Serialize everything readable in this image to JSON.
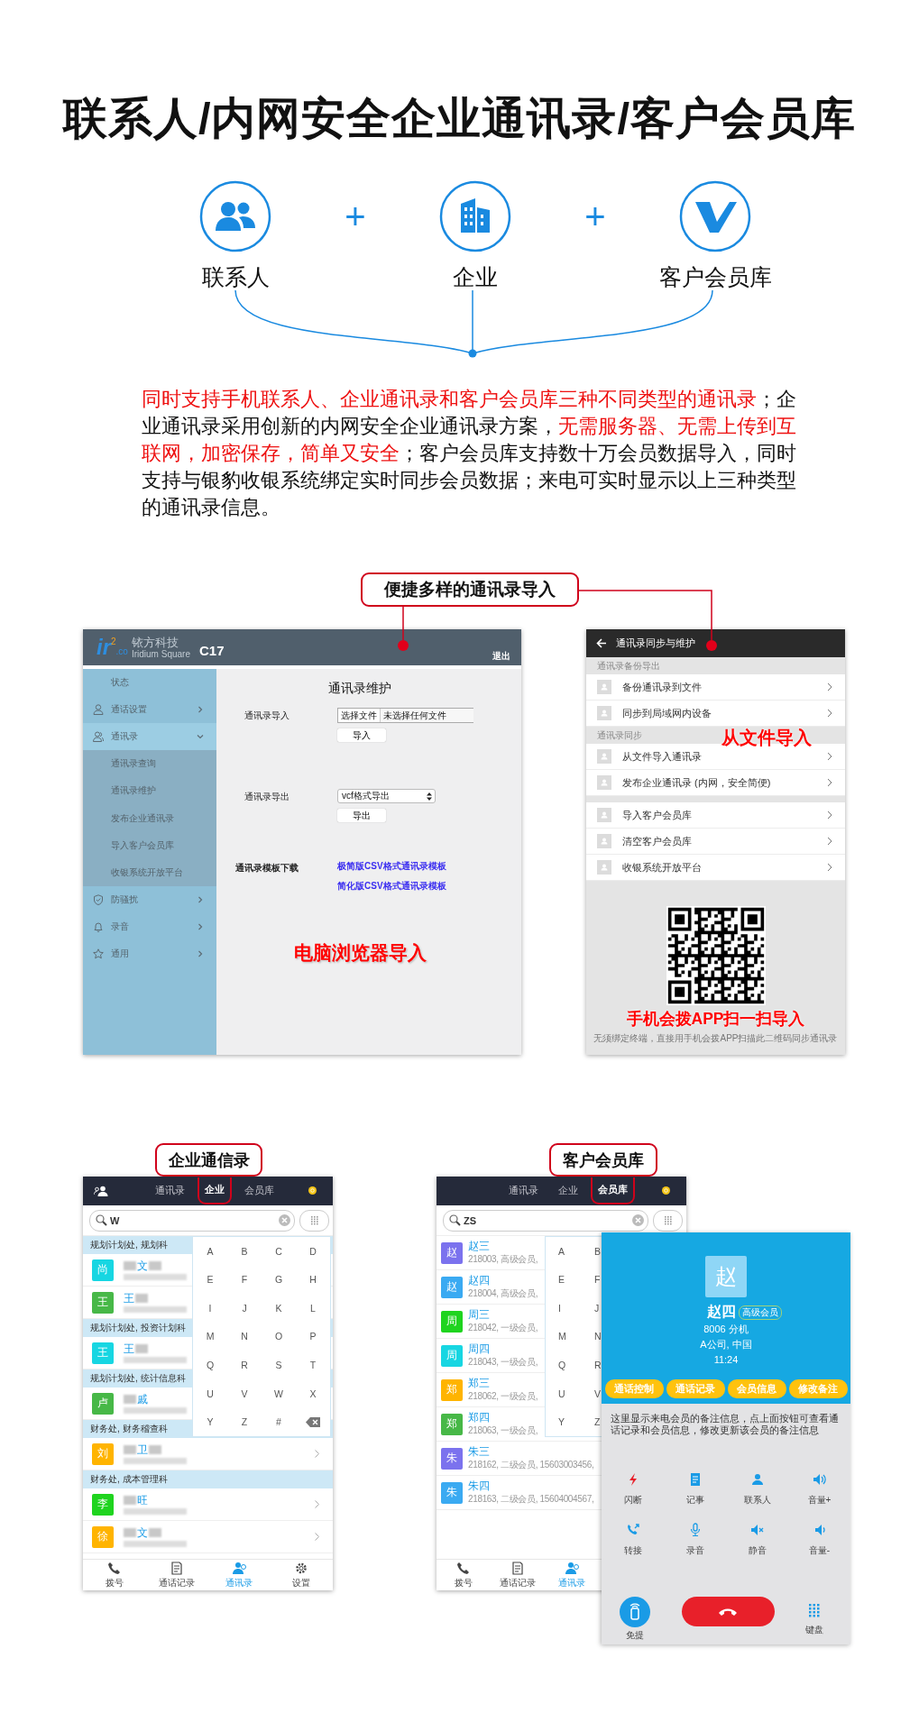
{
  "title": "联系人/内网安全企业通讯录/客户会员库",
  "features": [
    {
      "label": "联系人",
      "kind": "contacts"
    },
    {
      "label": "企业",
      "kind": "building"
    },
    {
      "label": "客户会员库",
      "kind": "logo"
    }
  ],
  "feature_joiners": [
    "+",
    "+"
  ],
  "description": [
    {
      "text": "同时支持手机联系人、企业通讯录和客户会员库三种不同类型的通讯录",
      "highlighted": true
    },
    {
      "text": "；企业通讯录采用创新的内网安全企业通讯录方案，",
      "highlighted": false
    },
    {
      "text": "无需服务器、无需上传到互联网，加密保存，简单又安全",
      "highlighted": true
    },
    {
      "text": "；客户会员库支持数十万会员数据导入，同时支持与银豹收银系统绑定实时同步会员数据；来电可实时显示以上三种类型的通讯录信息。",
      "highlighted": false
    }
  ],
  "import_callout": "便捷多样的通讯录导入",
  "web_admin": {
    "logo_letters": "ir",
    "logo_exponent": "2",
    "logo_domain": ".co",
    "brand": "铱方科技",
    "brand_sub": "Iridium Square",
    "model": "C17",
    "logout": "退出",
    "menu": [
      {
        "label": "状态",
        "kind": "plain",
        "expandable": false
      },
      {
        "label": "通话设置",
        "kind": "person",
        "expandable": true,
        "expanded": false
      },
      {
        "label": "通讯录",
        "kind": "people",
        "expandable": true,
        "expanded": true,
        "children": [
          {
            "label": "通讯录查询"
          },
          {
            "label": "通讯录维护"
          },
          {
            "label": "发布企业通讯录"
          },
          {
            "label": "导入客户会员库"
          },
          {
            "label": "收银系统开放平台"
          }
        ]
      },
      {
        "label": "防骚扰",
        "kind": "shield",
        "expandable": true,
        "expanded": false
      },
      {
        "label": "录音",
        "kind": "bell",
        "expandable": true,
        "expanded": false
      },
      {
        "label": "通用",
        "kind": "star",
        "expandable": true,
        "expanded": false
      }
    ],
    "heading": "通讯录维护",
    "import": {
      "label": "通讯录导入",
      "file_button": "选择文件",
      "file_status": "未选择任何文件",
      "button": "导入"
    },
    "export": {
      "label": "通讯录导出",
      "format": "vcf格式导出",
      "button": "导出"
    },
    "templates": {
      "label": "通讯录模板下载",
      "links": [
        "极简版CSV格式通讯录模板",
        "简化版CSV格式通讯录模板"
      ]
    },
    "caption": "电脑浏览器导入"
  },
  "mobile_sync": {
    "title": "通讯录同步与维护",
    "sections": [
      {
        "header": "通讯录备份导出",
        "items": [
          "备份通讯录到文件",
          "同步到局域网内设备"
        ]
      },
      {
        "header": "通讯录同步",
        "items": [
          "从文件导入通讯录",
          "发布企业通讯录 (内网，安全简便)"
        ]
      },
      {
        "items": [
          "导入客户会员库",
          "清空客户会员库",
          "收银系统开放平台"
        ]
      }
    ],
    "overlay_caption": "从文件导入",
    "qr_caption": "手机会拨APP扫一扫导入",
    "qr_note": "无须绑定终端，直接用手机会拨APP扫描此二维码同步通讯录"
  },
  "enterprise_phone": {
    "callout": "企业通信录",
    "account_icon": true,
    "tabs": [
      {
        "label": "通讯录",
        "selected": false
      },
      {
        "label": "企业",
        "selected": true
      },
      {
        "label": "会员库",
        "selected": false
      }
    ],
    "search": {
      "value": "W"
    },
    "groups": [
      {
        "header": "规划计划处, 规划科",
        "contacts": [
          {
            "avatar": "尚",
            "color": "#17d6e2",
            "name": "文",
            "kind": "both"
          },
          {
            "avatar": "王",
            "color": "#47b847",
            "name": "王",
            "kind": "after"
          }
        ]
      },
      {
        "header": "规划计划处, 投资计划科",
        "contacts": [
          {
            "avatar": "王",
            "color": "#17d6e2",
            "name": "王",
            "kind": "after"
          }
        ]
      },
      {
        "header": "规划计划处, 统计信息科",
        "contacts": [
          {
            "avatar": "卢",
            "color": "#47b847",
            "name": "戚",
            "kind": "before"
          }
        ]
      },
      {
        "header": "财务处, 财务稽查科",
        "contacts": [
          {
            "avatar": "刘",
            "color": "#ffb400",
            "name": "卫",
            "kind": "both",
            "arrow": true
          }
        ]
      },
      {
        "header": "财务处, 成本管理科",
        "contacts": [
          {
            "avatar": "李",
            "color": "#1fd41f",
            "name": "旺",
            "kind": "before",
            "arrow": true
          },
          {
            "avatar": "徐",
            "color": "#ffb400",
            "name": "文",
            "kind": "both",
            "arrow": true
          }
        ]
      }
    ],
    "keyboard": [
      [
        "A",
        "B",
        "C",
        "D"
      ],
      [
        "E",
        "F",
        "G",
        "H"
      ],
      [
        "I",
        "J",
        "K",
        "L"
      ],
      [
        "M",
        "N",
        "O",
        "P"
      ],
      [
        "Q",
        "R",
        "S",
        "T"
      ],
      [
        "U",
        "V",
        "W",
        "X"
      ],
      [
        "Y",
        "Z",
        "#"
      ]
    ],
    "delete_key": true,
    "nav": [
      {
        "label": "拨号",
        "kind": "phone",
        "selected": false
      },
      {
        "label": "通话记录",
        "kind": "history",
        "selected": false
      },
      {
        "label": "通讯录",
        "kind": "contacts",
        "selected": true
      },
      {
        "label": "设置",
        "kind": "gear",
        "selected": false
      }
    ]
  },
  "member_phone": {
    "callout": "客户会员库",
    "tabs": [
      {
        "label": "通讯录",
        "selected": false
      },
      {
        "label": "企业",
        "selected": false
      },
      {
        "label": "会员库",
        "selected": true
      }
    ],
    "search": {
      "value": "ZS"
    },
    "members": [
      {
        "avatar": "赵",
        "color": "#7b72ee",
        "name": "赵三",
        "detail": "218003, 高级会员,"
      },
      {
        "avatar": "赵",
        "color": "#3aaaf2",
        "name": "赵四",
        "detail": "218004, 高级会员,"
      },
      {
        "avatar": "周",
        "color": "#1fd41f",
        "name": "周三",
        "detail": "218042, 一级会员,"
      },
      {
        "avatar": "周",
        "color": "#17d6e2",
        "name": "周四",
        "detail": "218043, 一级会员,"
      },
      {
        "avatar": "郑",
        "color": "#ffb400",
        "name": "郑三",
        "detail": "218062, 一级会员,"
      },
      {
        "avatar": "郑",
        "color": "#47b847",
        "name": "郑四",
        "detail": "218063, 一级会员,"
      },
      {
        "avatar": "朱",
        "color": "#7b72ee",
        "name": "朱三",
        "detail": "218162, 二级会员, 15603003456,"
      },
      {
        "avatar": "朱",
        "color": "#3aaaf2",
        "name": "朱四",
        "detail": "218163, 二级会员, 15604004567,"
      }
    ],
    "keyboard": [
      [
        "A",
        "B"
      ],
      [
        "E",
        "F"
      ],
      [
        "I",
        "J"
      ],
      [
        "M",
        "N"
      ],
      [
        "Q",
        "R"
      ],
      [
        "U",
        "V"
      ],
      [
        "Y",
        "Z"
      ]
    ],
    "nav": [
      {
        "label": "拨号",
        "kind": "phone",
        "selected": false
      },
      {
        "label": "通话记录",
        "kind": "history",
        "selected": false
      },
      {
        "label": "通讯录",
        "kind": "contacts",
        "selected": true
      }
    ]
  },
  "incoming_call": {
    "avatar": "赵",
    "name": "赵四",
    "badge": "高级会员",
    "extension": "8006 分机",
    "company": "A公司, 中国",
    "time": "11:24",
    "buttons": [
      "通话控制",
      "通话记录",
      "会员信息",
      "修改备注"
    ],
    "note": "这里显示来电会员的备注信息，点上面按钮可查看通话记录和会员信息，修改更新该会员的备注信息",
    "actions": [
      {
        "label": "闪断",
        "kind": "flash"
      },
      {
        "label": "记事",
        "kind": "note"
      },
      {
        "label": "联系人",
        "kind": "person"
      },
      {
        "label": "音量+",
        "kind": "volume-up"
      },
      {
        "label": "转接",
        "kind": "transfer"
      },
      {
        "label": "录音",
        "kind": "mic"
      },
      {
        "label": "静音",
        "kind": "mute"
      },
      {
        "label": "音量-",
        "kind": "volume-down"
      }
    ],
    "speaker": "免提",
    "keypad": "键盘"
  }
}
